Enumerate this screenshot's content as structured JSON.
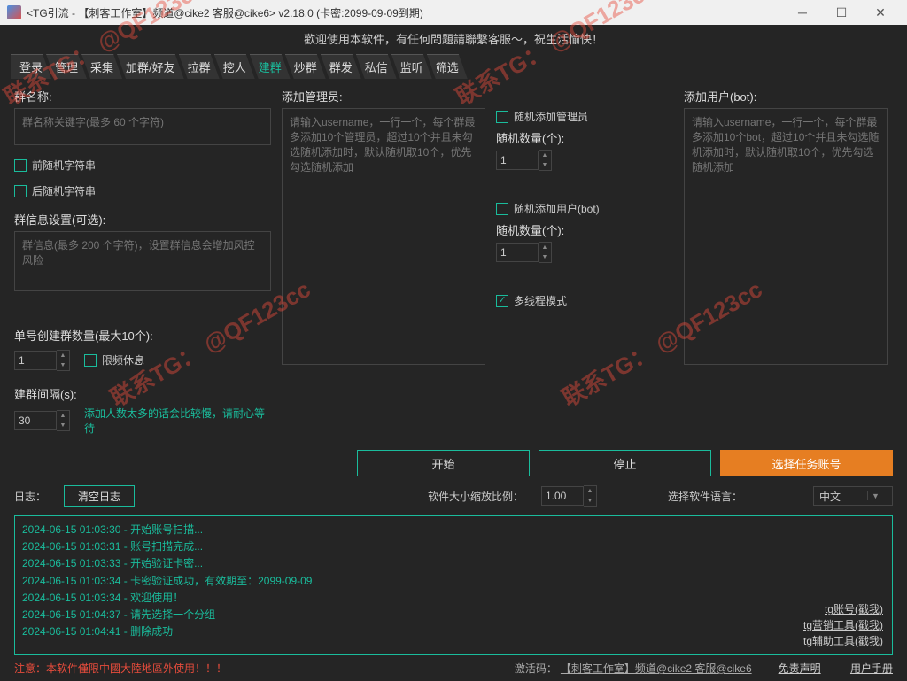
{
  "titlebar": {
    "title": "<TG引流 - 【刺客工作室】频道@cike2 客服@cike6> v2.18.0 (卡密:2099-09-09到期)"
  },
  "welcome": "歡迎使用本软件，有任何問題請聯繫客服～，祝生活愉快！",
  "tabs": [
    "登录",
    "管理",
    "采集",
    "加群/好友",
    "拉群",
    "挖人",
    "建群",
    "炒群",
    "群发",
    "私信",
    "监听",
    "筛选"
  ],
  "activeTab": 6,
  "col1": {
    "groupNameLabel": "群名称:",
    "groupNamePh": "群名称关键字(最多 60 个字符)",
    "chkPre": "前随机字符串",
    "chkPost": "后随机字符串",
    "groupInfoLabel": "群信息设置(可选):",
    "groupInfoPh": "群信息(最多 200 个字符)，设置群信息会增加风控风险",
    "singleLabel": "单号创建群数量(最大10个):",
    "singleVal": "1",
    "chkRest": "限频休息",
    "intervalLabel": "建群间隔(s):",
    "intervalVal": "30",
    "hint": "添加人数太多的话会比较慢，请耐心等待"
  },
  "col2": {
    "adminLabel": "添加管理员:",
    "adminPh": "请输入username，一行一个，每个群最多添加10个管理员，超过10个并且未勾选随机添加时，默认随机取10个，优先勾选随机添加"
  },
  "col3": {
    "chkRandAdmin": "随机添加管理员",
    "randCountLabel1": "随机数量(个):",
    "randCountVal1": "1",
    "chkRandBot": "随机添加用户(bot)",
    "randCountLabel2": "随机数量(个):",
    "randCountVal2": "1",
    "chkMulti": "多线程模式"
  },
  "col4": {
    "botLabel": "添加用户(bot):",
    "botPh": "请输入username，一行一个，每个群最多添加10个bot，超过10个并且未勾选随机添加时，默认随机取10个，优先勾选随机添加"
  },
  "buttons": {
    "start": "开始",
    "stop": "停止",
    "select": "选择任务账号"
  },
  "midrow": {
    "logLabel": "日志：",
    "clearLog": "清空日志",
    "zoomLabel": "软件大小缩放比例：",
    "zoomVal": "1.00",
    "langLabel": "选择软件语言：",
    "langVal": "中文"
  },
  "logs": [
    "2024-06-15 01:03:30 - 开始账号扫描...",
    "2024-06-15 01:03:31 - 账号扫描完成...",
    "2024-06-15 01:03:33 - 开始验证卡密...",
    "2024-06-15 01:03:34 - 卡密验证成功，有效期至：2099-09-09",
    "2024-06-15 01:03:34 - 欢迎使用！",
    "2024-06-15 01:04:37 - 请先选择一个分组",
    "2024-06-15 01:04:41 - 删除成功"
  ],
  "loglinks": [
    "tg账号(戳我)",
    "tg营销工具(戳我)",
    "tg辅助工具(戳我)"
  ],
  "footer": {
    "warn": "注意：本软件僅限中國大陸地區外使用！！！",
    "activate": "激活码：",
    "channel": "【刺客工作室】频道@cike2 客服@cike6",
    "disclaimer": "免责声明",
    "manual": "用户手册"
  },
  "watermark": "联系TG：\n@QF123cc"
}
